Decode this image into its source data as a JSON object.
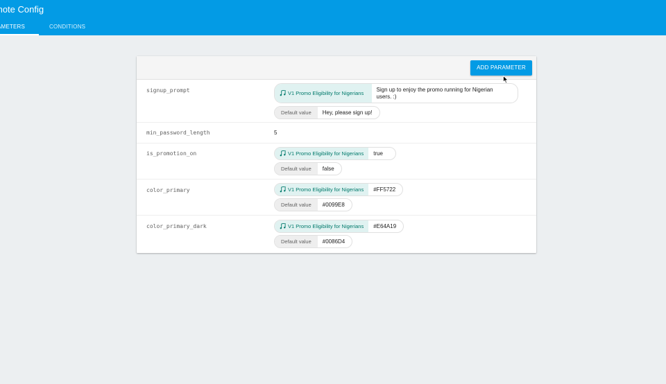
{
  "app": {
    "title": "mote Config"
  },
  "tabs": [
    {
      "label": "RAMETERS"
    },
    {
      "label": "CONDITIONS"
    }
  ],
  "header": {
    "add_parameter_label": "ADD PARAMETER"
  },
  "parameters": [
    {
      "key": "signup_prompt",
      "condition": "V1 Promo Eligibility for Nigerians",
      "condition_value": "Sign up to enjoy the promo running for Nigerian users. :)",
      "default_label": "Default value",
      "default_value": "Hey, please sign up!"
    },
    {
      "key": "min_password_length",
      "value": "5"
    },
    {
      "key": "is_promotion_on",
      "condition": "V1 Promo Eligibility for Nigerians",
      "condition_value": "true",
      "default_label": "Default value",
      "default_value": "false"
    },
    {
      "key": "color_primary",
      "condition": "V1 Promo Eligibility for Nigerians",
      "condition_value": "#FF5722",
      "default_label": "Default value",
      "default_value": "#0099E8"
    },
    {
      "key": "color_primary_dark",
      "condition": "V1 Promo Eligibility for Nigerians",
      "condition_value": "#E64A19",
      "default_label": "Default value",
      "default_value": "#0086D4"
    }
  ],
  "colors": {
    "appbar": "#039be5",
    "condition_bg": "#e0f2f1",
    "condition_text": "#00796b"
  },
  "icons": {
    "condition": "condition-music-icon"
  }
}
